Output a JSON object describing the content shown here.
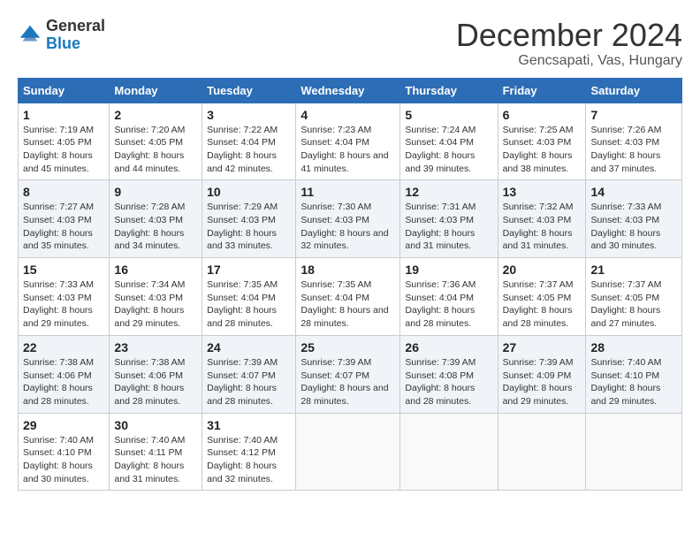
{
  "logo": {
    "general": "General",
    "blue": "Blue"
  },
  "title": "December 2024",
  "location": "Gencsapati, Vas, Hungary",
  "days_of_week": [
    "Sunday",
    "Monday",
    "Tuesday",
    "Wednesday",
    "Thursday",
    "Friday",
    "Saturday"
  ],
  "weeks": [
    [
      {
        "day": "1",
        "sunrise": "7:19 AM",
        "sunset": "4:05 PM",
        "daylight": "8 hours and 45 minutes."
      },
      {
        "day": "2",
        "sunrise": "7:20 AM",
        "sunset": "4:05 PM",
        "daylight": "8 hours and 44 minutes."
      },
      {
        "day": "3",
        "sunrise": "7:22 AM",
        "sunset": "4:04 PM",
        "daylight": "8 hours and 42 minutes."
      },
      {
        "day": "4",
        "sunrise": "7:23 AM",
        "sunset": "4:04 PM",
        "daylight": "8 hours and 41 minutes."
      },
      {
        "day": "5",
        "sunrise": "7:24 AM",
        "sunset": "4:04 PM",
        "daylight": "8 hours and 39 minutes."
      },
      {
        "day": "6",
        "sunrise": "7:25 AM",
        "sunset": "4:03 PM",
        "daylight": "8 hours and 38 minutes."
      },
      {
        "day": "7",
        "sunrise": "7:26 AM",
        "sunset": "4:03 PM",
        "daylight": "8 hours and 37 minutes."
      }
    ],
    [
      {
        "day": "8",
        "sunrise": "7:27 AM",
        "sunset": "4:03 PM",
        "daylight": "8 hours and 35 minutes."
      },
      {
        "day": "9",
        "sunrise": "7:28 AM",
        "sunset": "4:03 PM",
        "daylight": "8 hours and 34 minutes."
      },
      {
        "day": "10",
        "sunrise": "7:29 AM",
        "sunset": "4:03 PM",
        "daylight": "8 hours and 33 minutes."
      },
      {
        "day": "11",
        "sunrise": "7:30 AM",
        "sunset": "4:03 PM",
        "daylight": "8 hours and 32 minutes."
      },
      {
        "day": "12",
        "sunrise": "7:31 AM",
        "sunset": "4:03 PM",
        "daylight": "8 hours and 31 minutes."
      },
      {
        "day": "13",
        "sunrise": "7:32 AM",
        "sunset": "4:03 PM",
        "daylight": "8 hours and 31 minutes."
      },
      {
        "day": "14",
        "sunrise": "7:33 AM",
        "sunset": "4:03 PM",
        "daylight": "8 hours and 30 minutes."
      }
    ],
    [
      {
        "day": "15",
        "sunrise": "7:33 AM",
        "sunset": "4:03 PM",
        "daylight": "8 hours and 29 minutes."
      },
      {
        "day": "16",
        "sunrise": "7:34 AM",
        "sunset": "4:03 PM",
        "daylight": "8 hours and 29 minutes."
      },
      {
        "day": "17",
        "sunrise": "7:35 AM",
        "sunset": "4:04 PM",
        "daylight": "8 hours and 28 minutes."
      },
      {
        "day": "18",
        "sunrise": "7:35 AM",
        "sunset": "4:04 PM",
        "daylight": "8 hours and 28 minutes."
      },
      {
        "day": "19",
        "sunrise": "7:36 AM",
        "sunset": "4:04 PM",
        "daylight": "8 hours and 28 minutes."
      },
      {
        "day": "20",
        "sunrise": "7:37 AM",
        "sunset": "4:05 PM",
        "daylight": "8 hours and 28 minutes."
      },
      {
        "day": "21",
        "sunrise": "7:37 AM",
        "sunset": "4:05 PM",
        "daylight": "8 hours and 27 minutes."
      }
    ],
    [
      {
        "day": "22",
        "sunrise": "7:38 AM",
        "sunset": "4:06 PM",
        "daylight": "8 hours and 28 minutes."
      },
      {
        "day": "23",
        "sunrise": "7:38 AM",
        "sunset": "4:06 PM",
        "daylight": "8 hours and 28 minutes."
      },
      {
        "day": "24",
        "sunrise": "7:39 AM",
        "sunset": "4:07 PM",
        "daylight": "8 hours and 28 minutes."
      },
      {
        "day": "25",
        "sunrise": "7:39 AM",
        "sunset": "4:07 PM",
        "daylight": "8 hours and 28 minutes."
      },
      {
        "day": "26",
        "sunrise": "7:39 AM",
        "sunset": "4:08 PM",
        "daylight": "8 hours and 28 minutes."
      },
      {
        "day": "27",
        "sunrise": "7:39 AM",
        "sunset": "4:09 PM",
        "daylight": "8 hours and 29 minutes."
      },
      {
        "day": "28",
        "sunrise": "7:40 AM",
        "sunset": "4:10 PM",
        "daylight": "8 hours and 29 minutes."
      }
    ],
    [
      {
        "day": "29",
        "sunrise": "7:40 AM",
        "sunset": "4:10 PM",
        "daylight": "8 hours and 30 minutes."
      },
      {
        "day": "30",
        "sunrise": "7:40 AM",
        "sunset": "4:11 PM",
        "daylight": "8 hours and 31 minutes."
      },
      {
        "day": "31",
        "sunrise": "7:40 AM",
        "sunset": "4:12 PM",
        "daylight": "8 hours and 32 minutes."
      },
      null,
      null,
      null,
      null
    ]
  ],
  "labels": {
    "sunrise": "Sunrise:",
    "sunset": "Sunset:",
    "daylight": "Daylight:"
  }
}
